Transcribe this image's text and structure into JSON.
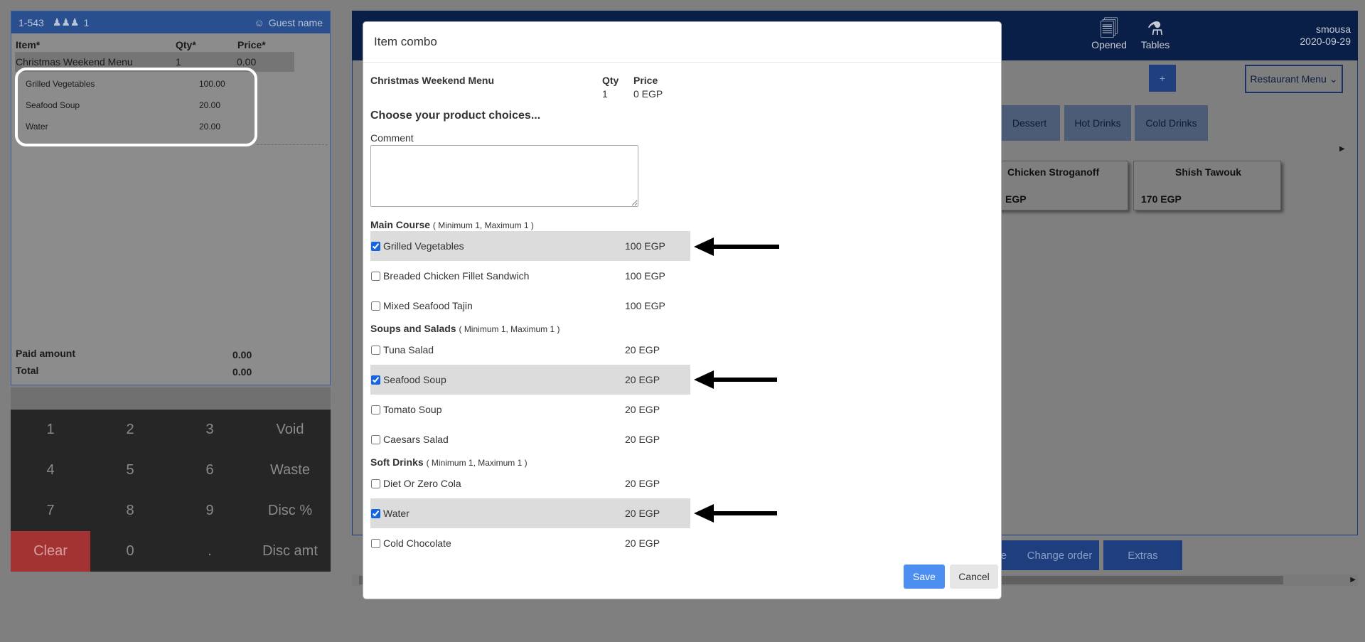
{
  "order_panel": {
    "header": {
      "table_no": "1-543",
      "guests": "1",
      "guest_name": "Guest name"
    },
    "columns": {
      "item": "Item*",
      "qty": "Qty*",
      "price": "Price*"
    },
    "item": {
      "name": "Christmas Weekend Menu",
      "qty": "1",
      "price": "0.00"
    },
    "combo_lines": [
      {
        "name": "Grilled Vegetables",
        "price": "100.00"
      },
      {
        "name": "Seafood Soup",
        "price": "20.00"
      },
      {
        "name": "Water",
        "price": "20.00"
      }
    ],
    "paid_amount_label": "Paid amount",
    "paid_amount": "0.00",
    "total_label": "Total",
    "total": "0.00"
  },
  "numpad": [
    "1",
    "2",
    "3",
    "Void",
    "4",
    "5",
    "6",
    "Waste",
    "7",
    "8",
    "9",
    "Disc %",
    "Clear",
    "0",
    ".",
    "Disc amt"
  ],
  "app": {
    "header_icons": [
      {
        "label": "Opened",
        "icon": "receipt-icon"
      },
      {
        "label": "Tables",
        "icon": "table-icon"
      }
    ],
    "user": {
      "name": "smousa",
      "date": "2020-09-29"
    },
    "plus_label": "+",
    "menu_select": "Restaurant Menu",
    "categories": [
      "Dessert",
      "Hot Drinks",
      "Cold Drinks"
    ],
    "products": [
      {
        "name": "Chicken Stroganoff",
        "price": "EGP"
      },
      {
        "name": "Shish Tawouk",
        "price": "170 EGP"
      }
    ],
    "actions": [
      "e",
      "Change order",
      "Extras"
    ]
  },
  "modal": {
    "title": "Item combo",
    "item_name": "Christmas Weekend Menu",
    "qty_label": "Qty",
    "qty": "1",
    "price_label": "Price",
    "price": "0 EGP",
    "choose_heading": "Choose your product choices...",
    "comment_label": "Comment",
    "groups": [
      {
        "title": "Main Course",
        "constraint": "( Minimum 1, Maximum 1 )",
        "choices": [
          {
            "name": "Grilled Vegetables",
            "price": "100 EGP",
            "checked": true
          },
          {
            "name": "Breaded Chicken Fillet Sandwich",
            "price": "100 EGP",
            "checked": false
          },
          {
            "name": "Mixed Seafood Tajin",
            "price": "100 EGP",
            "checked": false
          }
        ]
      },
      {
        "title": "Soups and Salads",
        "constraint": "( Minimum 1, Maximum 1 )",
        "choices": [
          {
            "name": "Tuna Salad",
            "price": "20 EGP",
            "checked": false
          },
          {
            "name": "Seafood Soup",
            "price": "20 EGP",
            "checked": true
          },
          {
            "name": "Tomato Soup",
            "price": "20 EGP",
            "checked": false
          },
          {
            "name": "Caesars Salad",
            "price": "20 EGP",
            "checked": false
          }
        ]
      },
      {
        "title": "Soft Drinks",
        "constraint": "( Minimum 1, Maximum 1 )",
        "choices": [
          {
            "name": "Diet Or Zero Cola",
            "price": "20 EGP",
            "checked": false
          },
          {
            "name": "Water",
            "price": "20 EGP",
            "checked": true
          },
          {
            "name": "Cold Chocolate",
            "price": "20 EGP",
            "checked": false
          }
        ]
      }
    ],
    "save_label": "Save",
    "cancel_label": "Cancel"
  },
  "colors": {
    "selected_row": "#dcdcdc",
    "save_button": "#4c8ff0",
    "clear_key": "#a33232",
    "header_navy": "#0a1f48"
  }
}
